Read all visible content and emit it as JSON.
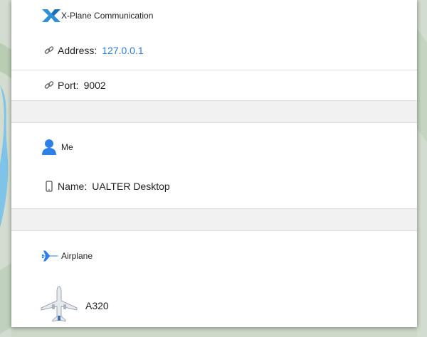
{
  "xplane": {
    "title": "X-Plane Communication",
    "address_label": "Address:",
    "address_value": "127.0.0.1",
    "port_label": "Port:",
    "port_value": "9002"
  },
  "me": {
    "title": "Me",
    "name_label": "Name:",
    "name_value": "UALTER Desktop"
  },
  "airplane": {
    "title": "Airplane",
    "model": "A320"
  },
  "colors": {
    "accent": "#2e7bd6",
    "icon_blue": "#2f80e6"
  }
}
